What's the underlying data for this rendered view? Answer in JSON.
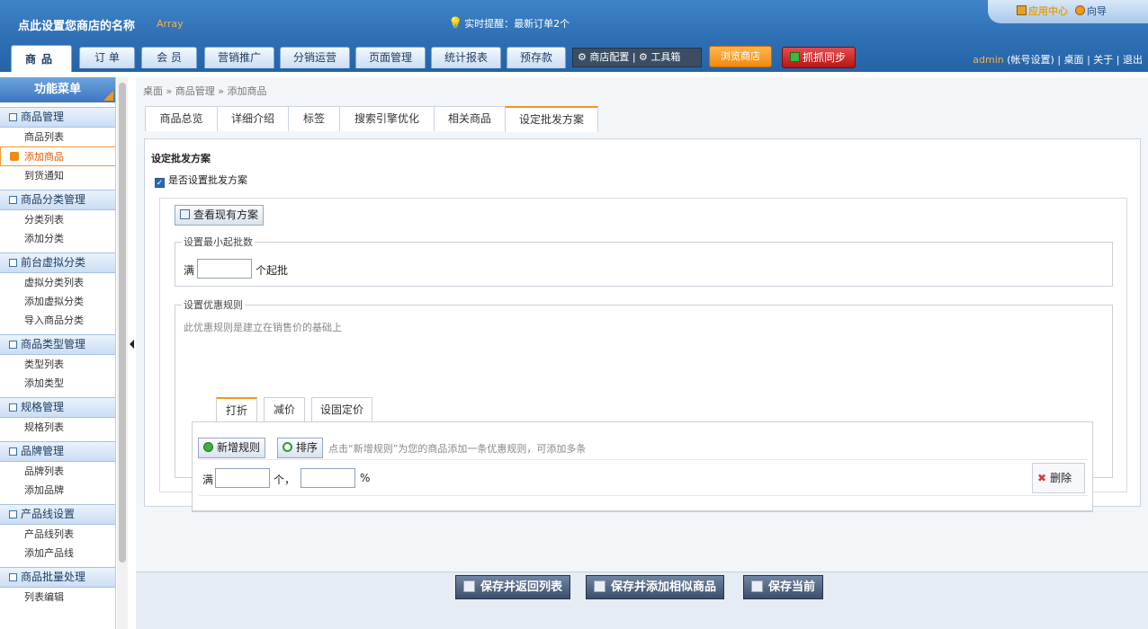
{
  "header": {
    "shop_name": "点此设置您商店的名称",
    "shop_suffix": "Array",
    "reminder_label": "实时提醒：",
    "reminder_text": "最新订单2个",
    "app_center": "应用中心",
    "guide": "向导"
  },
  "nav": {
    "tabs": [
      {
        "label": "商品"
      },
      {
        "label": "订 单"
      },
      {
        "label": "会 员"
      },
      {
        "label": "营销推广"
      },
      {
        "label": "分销运营"
      },
      {
        "label": "页面管理"
      },
      {
        "label": "统计报表"
      },
      {
        "label": "预存款"
      }
    ],
    "config_label": "⚙ 商店配置 | ⚙ 工具箱",
    "browse_store": "浏览商店",
    "sync": "抓抓同步"
  },
  "userbar": {
    "username": "admin",
    "account_settings": "(帐号设置)",
    "sep": "|",
    "desktop": "桌面",
    "about": "关于",
    "logout": "退出"
  },
  "sidebar": {
    "title": "功能菜单",
    "groups": [
      {
        "label": "商品管理",
        "items": [
          {
            "label": "商品列表"
          },
          {
            "label": "添加商品"
          },
          {
            "label": "到货通知"
          }
        ]
      },
      {
        "label": "商品分类管理",
        "items": [
          {
            "label": "分类列表"
          },
          {
            "label": "添加分类"
          }
        ]
      },
      {
        "label": "前台虚拟分类",
        "items": [
          {
            "label": "虚拟分类列表"
          },
          {
            "label": "添加虚拟分类"
          },
          {
            "label": "导入商品分类"
          }
        ]
      },
      {
        "label": "商品类型管理",
        "items": [
          {
            "label": "类型列表"
          },
          {
            "label": "添加类型"
          }
        ]
      },
      {
        "label": "规格管理",
        "items": [
          {
            "label": "规格列表"
          }
        ]
      },
      {
        "label": "品牌管理",
        "items": [
          {
            "label": "品牌列表"
          },
          {
            "label": "添加品牌"
          }
        ]
      },
      {
        "label": "产品线设置",
        "items": [
          {
            "label": "产品线列表"
          },
          {
            "label": "添加产品线"
          }
        ]
      },
      {
        "label": "商品批量处理",
        "items": [
          {
            "label": "列表编辑"
          }
        ]
      }
    ]
  },
  "breadcrumb": "桌面 » 商品管理 » 添加商品",
  "tabs": [
    {
      "label": "商品总览"
    },
    {
      "label": "详细介绍"
    },
    {
      "label": "标签"
    },
    {
      "label": "搜索引擎优化"
    },
    {
      "label": "相关商品"
    },
    {
      "label": "设定批发方案"
    }
  ],
  "wholesale": {
    "title": "设定批发方案",
    "enable_label": "是否设置批发方案",
    "enabled": true,
    "view_button": "查看现有方案",
    "min_batch": {
      "legend": "设置最小起批数",
      "prefix": "满",
      "value": "",
      "suffix": "个起批"
    },
    "discount": {
      "legend": "设置优惠规则",
      "note": "此优惠规则是建立在销售价的基础上",
      "tabs": [
        {
          "label": "打折"
        },
        {
          "label": "减价"
        },
        {
          "label": "设固定价"
        }
      ],
      "add_rule": "新增规则",
      "sort": "排序",
      "hint": "点击“新增规则”为您的商品添加一条优惠规则，可添加多条",
      "rule": {
        "prefix": "满",
        "qty_value": "",
        "qty_unit": "个，",
        "rate_value": "",
        "rate_unit": "%",
        "delete": "删除"
      }
    }
  },
  "footer": {
    "save_return": "保存并返回列表",
    "save_add_similar": "保存并添加相似商品",
    "save_current": "保存当前"
  }
}
